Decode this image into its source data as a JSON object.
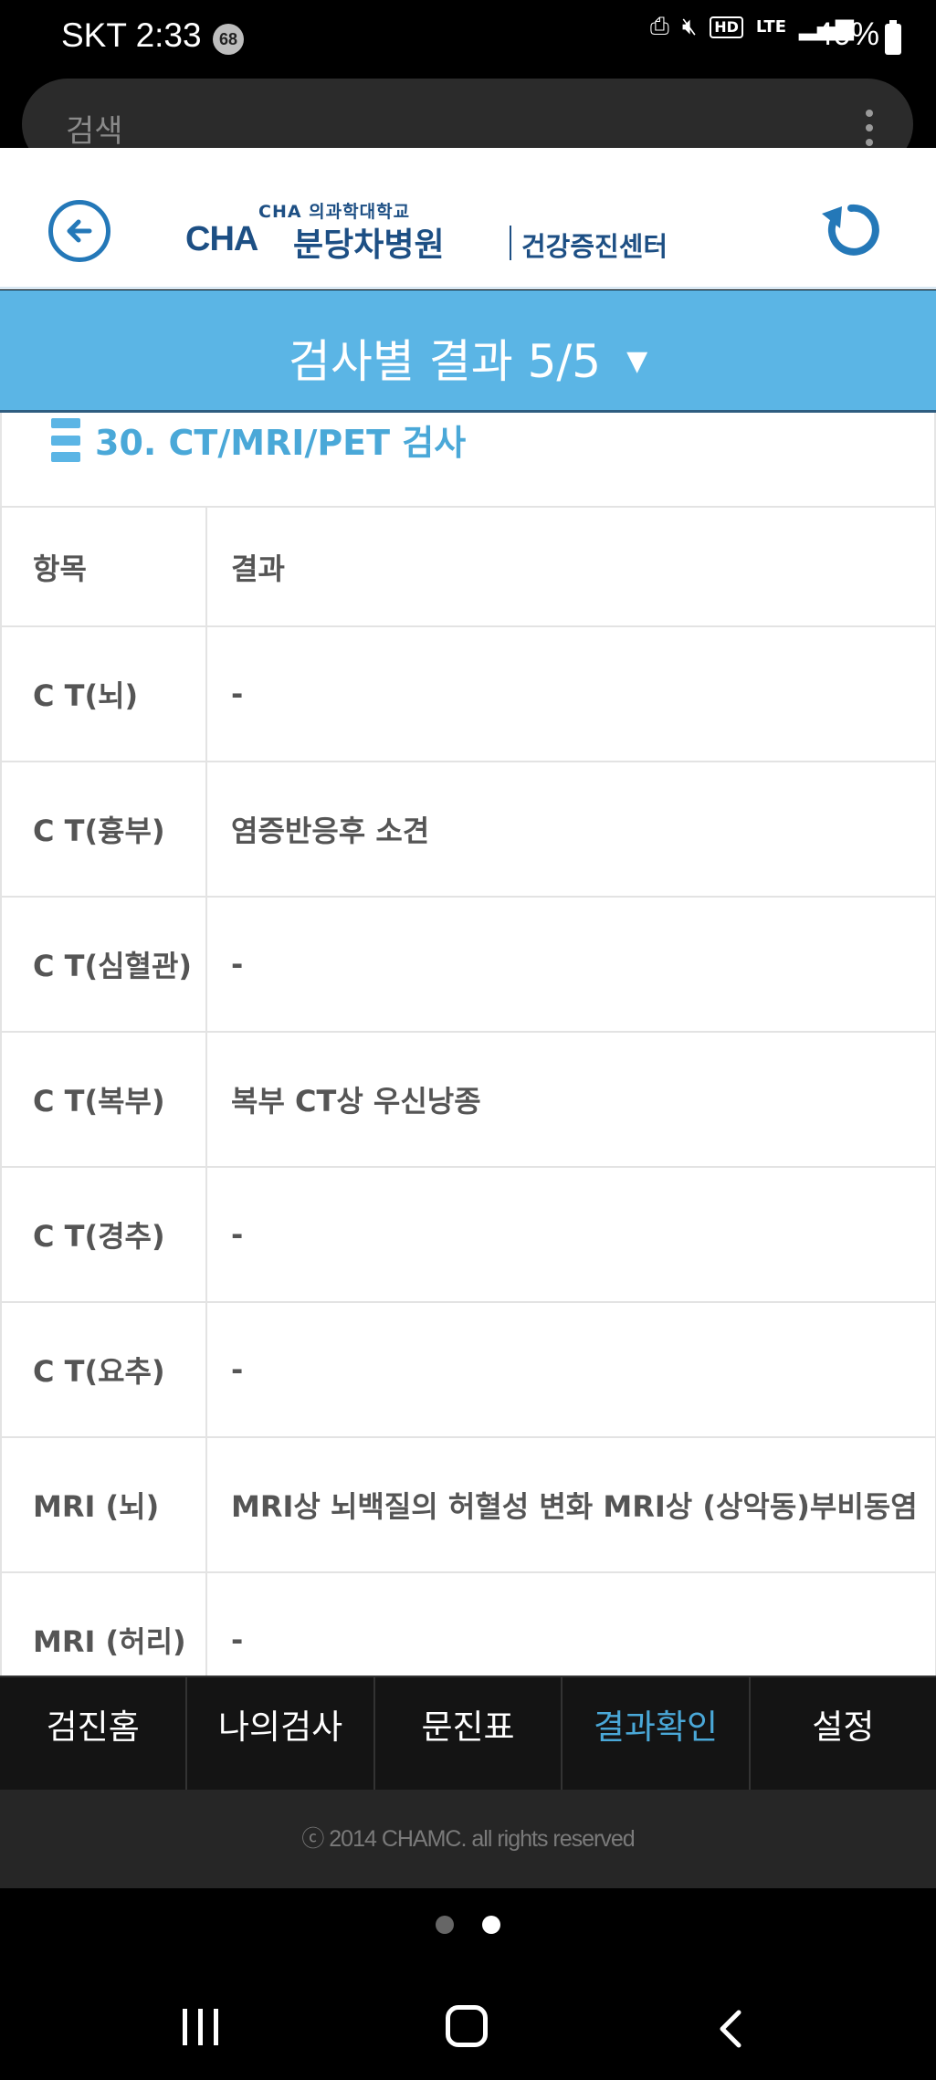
{
  "status_bar": {
    "carrier_time": "SKT 2:33",
    "notification_count": "68",
    "hd_label": "HD",
    "lte_label": "LTE",
    "battery": "40%"
  },
  "browser": {
    "search_placeholder": "검색"
  },
  "header": {
    "logo_sub": "CHA 의과학대학교",
    "logo_cha": "CHA",
    "logo_main": "분당차병원",
    "logo_center": "건강증진센터"
  },
  "title": {
    "text": "검사별 결과 5/5",
    "caret": "▼"
  },
  "section": {
    "title": "30. CT/MRI/PET 검사"
  },
  "table": {
    "headers": [
      "항목",
      "결과"
    ],
    "rows": [
      {
        "item": "C T(뇌)",
        "result": "-"
      },
      {
        "item": "C T(흉부)",
        "result": "염증반응후 소견"
      },
      {
        "item": "C T(심혈관)",
        "result": "-"
      },
      {
        "item": "C T(복부)",
        "result": "복부 CT상 우신낭종"
      },
      {
        "item": "C T(경추)",
        "result": "-"
      },
      {
        "item": "C T(요추)",
        "result": "-"
      },
      {
        "item": "MRI (뇌)",
        "result": "MRI상 뇌백질의 허혈성 변화 MRI상 (상악동)부비동염"
      },
      {
        "item": "MRI (허리)",
        "result": "-"
      }
    ]
  },
  "bottom_nav": {
    "items": [
      "검진홈",
      "나의검사",
      "문진표",
      "결과확인",
      "설정"
    ],
    "active_index": 3
  },
  "footer": {
    "copyright": "ⓒ 2014 CHAMC. all rights reserved"
  },
  "colors": {
    "accent": "#5bb5e5",
    "accent_text": "#4aa8d8",
    "brand_navy": "#1d4f84",
    "nav_bg": "#141414"
  }
}
